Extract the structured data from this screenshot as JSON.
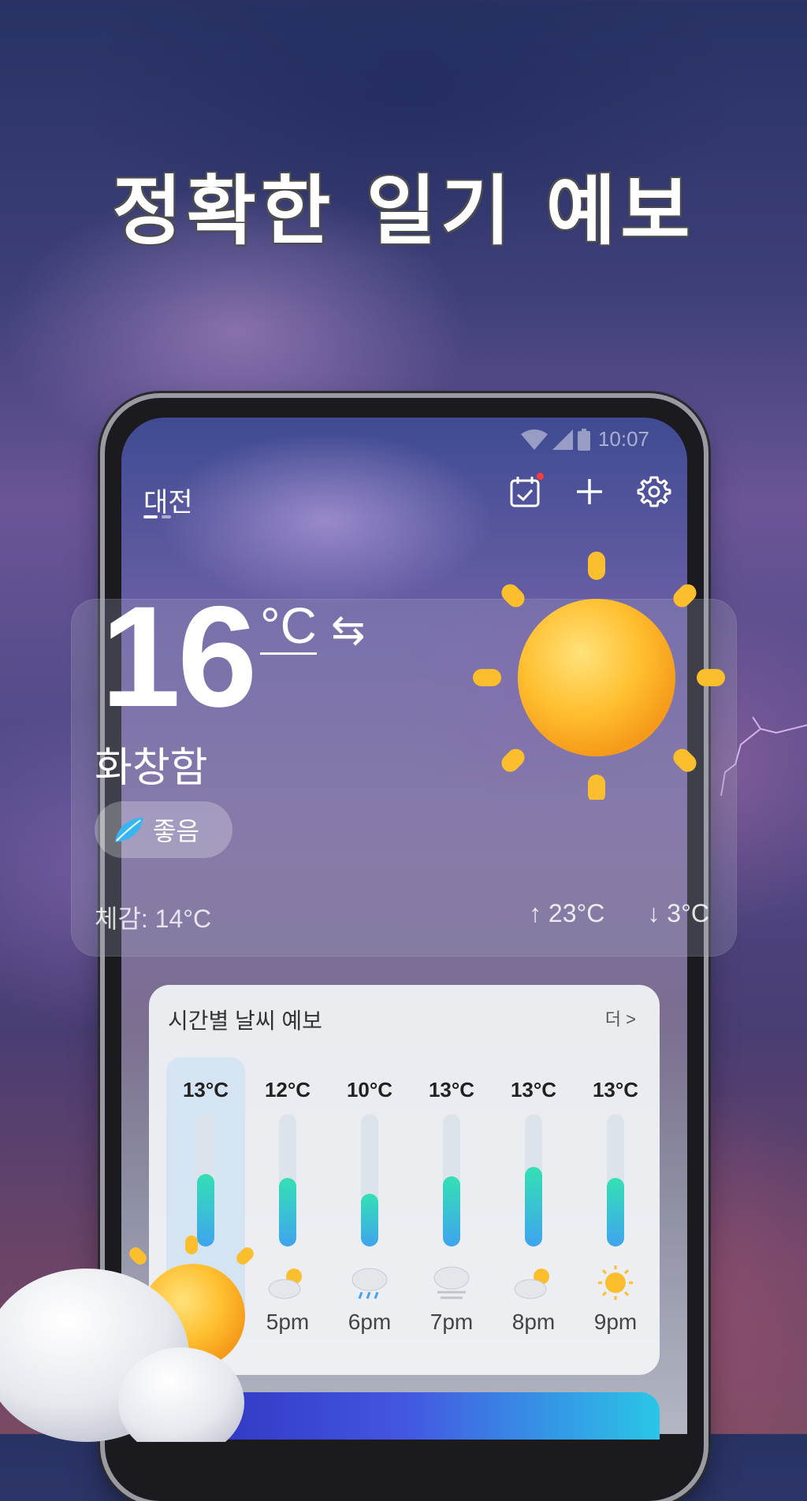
{
  "headline": "정확한 일기 예보",
  "status": {
    "time": "10:07"
  },
  "location": {
    "city": "대전"
  },
  "current": {
    "temperature": "16",
    "unit": "°C",
    "swap_symbol": "⇆",
    "condition": "화창함",
    "aqi_label": "좋음",
    "feels_like": "체감: 14°C",
    "high": "↑ 23°C",
    "low": "↓ 3°C"
  },
  "hourly": {
    "title": "시간별 날씨 예보",
    "more": "더 >",
    "items": [
      {
        "temp": "13°C",
        "time": "",
        "icon": "sunny-icon",
        "level": 0.55
      },
      {
        "temp": "12°C",
        "time": "5pm",
        "icon": "partly-cloudy-icon",
        "level": 0.52
      },
      {
        "temp": "10°C",
        "time": "6pm",
        "icon": "rain-icon",
        "level": 0.4
      },
      {
        "temp": "13°C",
        "time": "7pm",
        "icon": "fog-icon",
        "level": 0.53
      },
      {
        "temp": "13°C",
        "time": "8pm",
        "icon": "partly-cloudy-icon",
        "level": 0.6
      },
      {
        "temp": "13°C",
        "time": "9pm",
        "icon": "sunny-icon",
        "level": 0.52
      }
    ]
  },
  "colors": {
    "accent_teal": "#34e0b4",
    "accent_blue": "#3fa4ef",
    "sun": "#f7b52a"
  }
}
